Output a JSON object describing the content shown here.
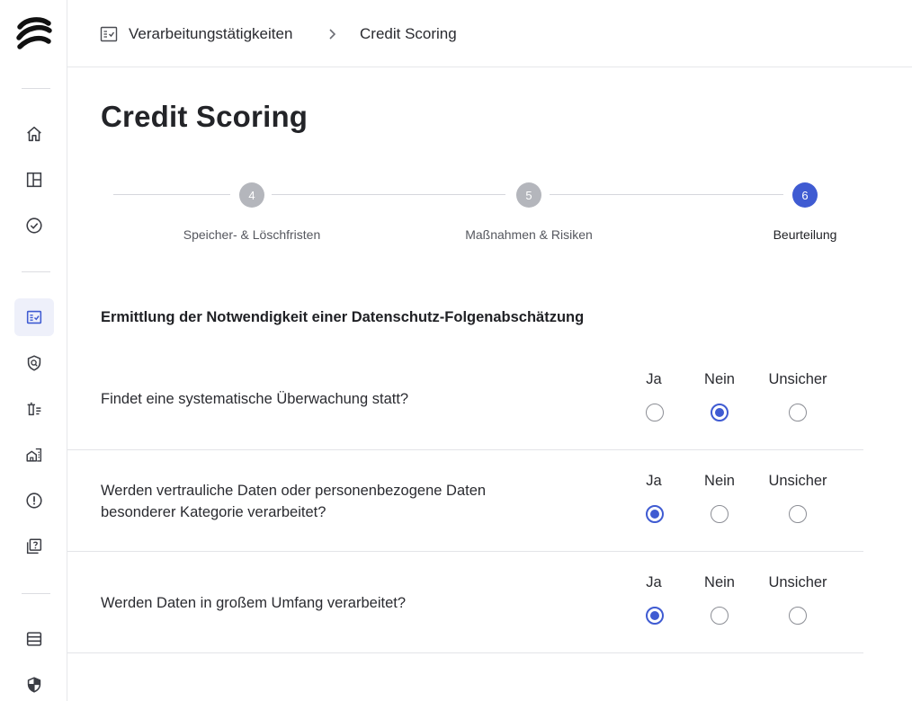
{
  "breadcrumb": {
    "items": [
      {
        "label": "Verarbeitungstätigkeiten"
      },
      {
        "label": "Credit Scoring"
      }
    ]
  },
  "page": {
    "title": "Credit Scoring"
  },
  "stepper": {
    "steps": [
      {
        "number": "4",
        "label": "Speicher- & Löschfristen",
        "active": false
      },
      {
        "number": "5",
        "label": "Maßnahmen & Risiken",
        "active": false
      },
      {
        "number": "6",
        "label": "Beurteilung",
        "active": true
      }
    ]
  },
  "assessment": {
    "section_title": "Ermittlung der Notwendigkeit einer Datenschutz-Folgenabschätzung",
    "options": [
      "Ja",
      "Nein",
      "Unsicher"
    ],
    "questions": [
      {
        "text": "Findet eine systematische Überwachung statt?",
        "selected": "Nein"
      },
      {
        "text": "Werden vertrauliche Daten oder personenbezogene Daten besonderer Kategorie verarbeitet?",
        "selected": "Ja"
      },
      {
        "text": "Werden Daten in großem Umfang verarbeitet?",
        "selected": "Ja"
      }
    ]
  },
  "sidebar": {
    "items": [
      {
        "icon": "home-icon"
      },
      {
        "icon": "layout-icon"
      },
      {
        "icon": "check-circle-icon"
      },
      {
        "icon": "processing-list-icon",
        "active": true
      },
      {
        "icon": "shield-search-icon"
      },
      {
        "icon": "delete-list-icon"
      },
      {
        "icon": "building-list-icon"
      },
      {
        "icon": "alert-circle-icon"
      },
      {
        "icon": "question-stack-icon"
      },
      {
        "icon": "database-icon"
      },
      {
        "icon": "security-shield-icon"
      }
    ]
  },
  "colors": {
    "accent": "#3f5bd2",
    "inactive_step": "#b4b6bc",
    "text": "#1f2024",
    "border": "#e6e7ea"
  }
}
